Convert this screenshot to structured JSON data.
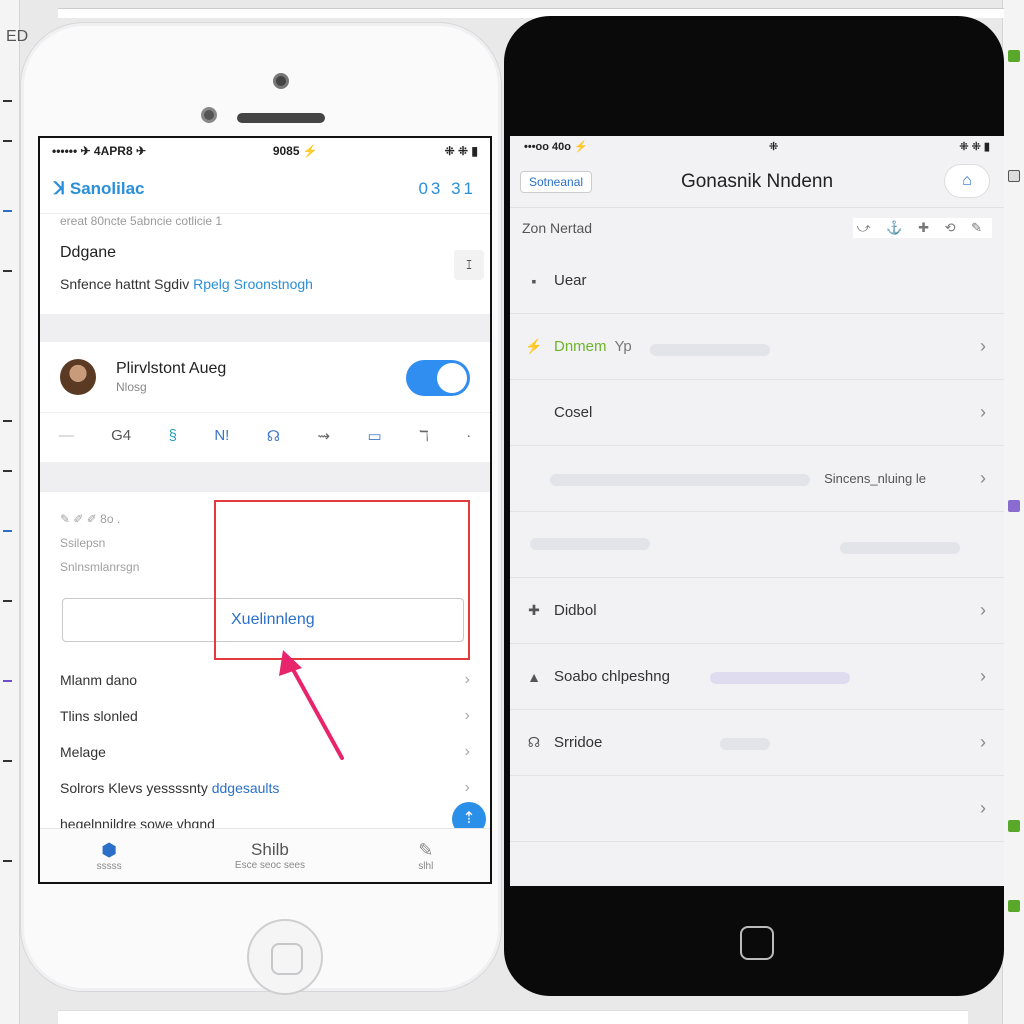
{
  "background": {
    "label": "ED"
  },
  "left_phone": {
    "status": {
      "carrier": "•••••• ✈ 4APR8 ✈",
      "time": "9085 ⚡",
      "right": "⁜ ⁜ ▮"
    },
    "nav": {
      "title": "ꓘ Sanolilac",
      "right_icons": "03 31"
    },
    "caption": "ereat 80ncte 5abncie cotlicie 1",
    "section": {
      "title": "Ddgane",
      "line_plain": "Snfence hattnt Sgdiv",
      "line_link": "Rpelg Sroonstnogh"
    },
    "side_icon": "ꕯ",
    "account": {
      "name": "Plirvlstont Aueg",
      "sub": "Nlosg",
      "toggle_state": "on"
    },
    "icon_row": [
      "—",
      "G4",
      "§",
      "N!",
      "☊",
      "⇝",
      "▭",
      "ℸ",
      "·"
    ],
    "card": {
      "faint_row": "✎ ✐ ✐ 8o .",
      "faint_1": "Ssilepsn",
      "faint_2": "Snlnsmlanrsgn",
      "button_label": "Xuelinnleng"
    },
    "list": [
      {
        "label": "Mlanm dano",
        "link": ""
      },
      {
        "label": "Tlins slonled",
        "link": ""
      },
      {
        "label": "Melage",
        "link": ""
      },
      {
        "label": "Solrors Klevs yessssnty",
        "link": "ddgesaults"
      },
      {
        "label": "hegelnnildre sowe vhgnd",
        "link": ""
      }
    ],
    "fab_icon": "⇡",
    "tabs": [
      {
        "icon": "⬢",
        "label": "sssss"
      },
      {
        "icon": "Shilb",
        "label": "Esce seoc sees"
      },
      {
        "icon": "✎",
        "label": "slhl"
      }
    ]
  },
  "right_phone": {
    "status": {
      "carrier": "•••oo 40o ⚡",
      "mid": "⁜",
      "right": "⁜ ⁜ ▮"
    },
    "nav": {
      "back_label": "Sotneanal",
      "title": "Gonasnik Nndenn",
      "avatar_icon": "⌂"
    },
    "subheader": {
      "label": "Zon Nertad",
      "tools": "⤻ ⚓ ✚ ⟲ ✎"
    },
    "rows": [
      {
        "icon": "▪",
        "label": "Uear",
        "right_text": "",
        "chevron": false
      },
      {
        "icon": "⚡",
        "label": "Dnmem",
        "suffix": "Yp",
        "right_text": "",
        "chevron": true
      },
      {
        "icon": "",
        "label": "Cosel",
        "right_text": "",
        "chevron": true
      },
      {
        "icon": "",
        "label": "",
        "right_text": "Sincens_nluing le",
        "chevron": true
      },
      {
        "icon": "",
        "label": "",
        "right_text": "",
        "chevron": false
      },
      {
        "icon": "✚",
        "label": "Didbol",
        "right_text": "",
        "chevron": true
      },
      {
        "icon": "▲",
        "label": "Soabo chlpeshng",
        "right_text": "",
        "chevron": true
      },
      {
        "icon": "☊",
        "label": "Srridoe",
        "right_text": "",
        "chevron": true
      },
      {
        "icon": "",
        "label": "",
        "right_text": "",
        "chevron": true
      }
    ]
  },
  "colors": {
    "accent_blue": "#2a8fd8",
    "toggle_blue": "#2f8ef0",
    "highlight_red": "#e23b3b",
    "arrow_pink": "#e8246c"
  }
}
